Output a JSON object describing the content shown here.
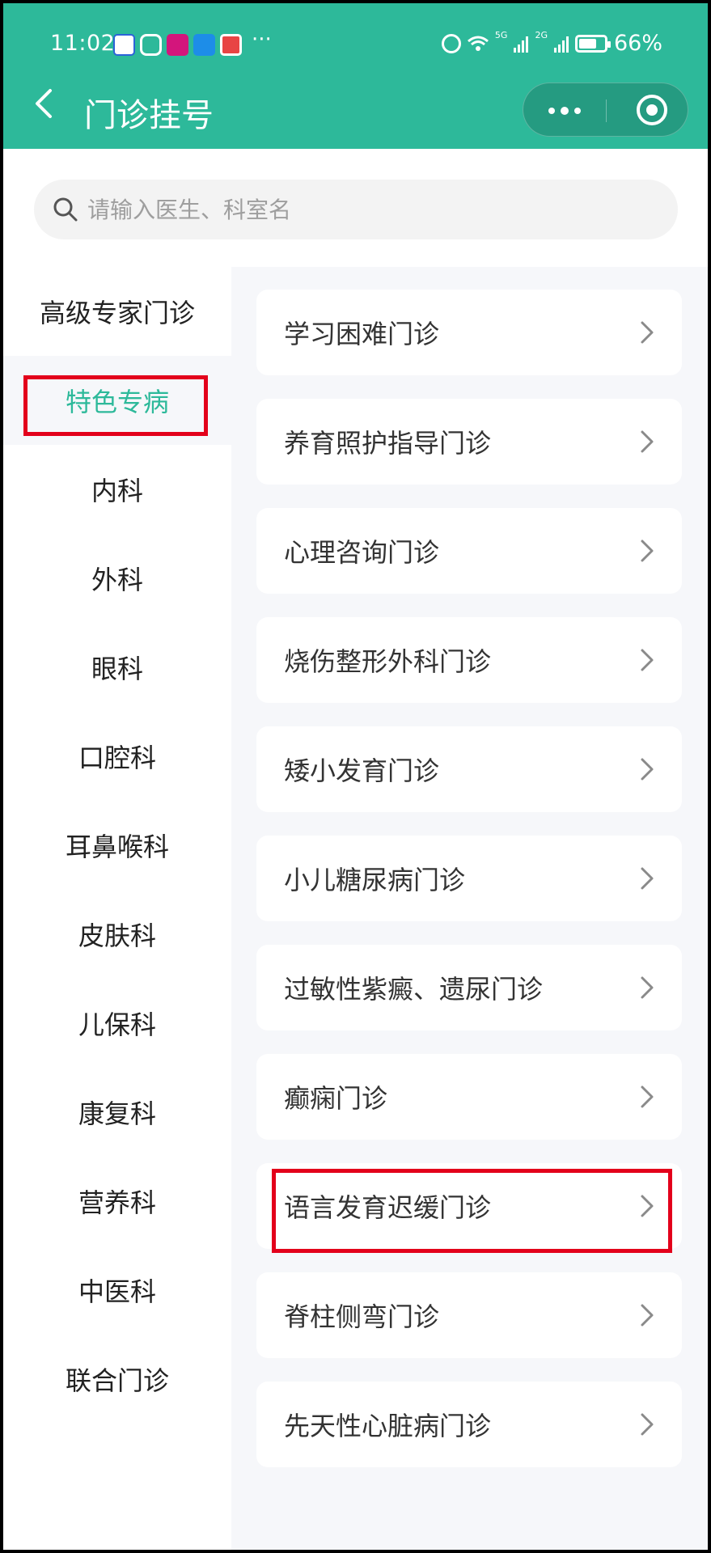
{
  "status_bar": {
    "time": "11:02",
    "more": "···",
    "battery_percent": "66%",
    "battery_level": 0.66,
    "app_icons": [
      "baidu-icon",
      "shield-icon",
      "pink-app-icon",
      "blue-app-icon",
      "red-app-icon"
    ],
    "network_tag_1": "5G",
    "network_tag_2": "2G"
  },
  "nav": {
    "title": "门诊挂号",
    "back_icon": "chevron-left-icon",
    "more_icon": "more-dots-icon",
    "close_icon": "target-circle-icon"
  },
  "search": {
    "placeholder": "请输入医生、科室名",
    "value": ""
  },
  "categories": [
    {
      "label": "高级专家门诊",
      "active": false
    },
    {
      "label": "特色专病",
      "active": true
    },
    {
      "label": "内科",
      "active": false
    },
    {
      "label": "外科",
      "active": false
    },
    {
      "label": "眼科",
      "active": false
    },
    {
      "label": "口腔科",
      "active": false
    },
    {
      "label": "耳鼻喉科",
      "active": false
    },
    {
      "label": "皮肤科",
      "active": false
    },
    {
      "label": "儿保科",
      "active": false
    },
    {
      "label": "康复科",
      "active": false
    },
    {
      "label": "营养科",
      "active": false
    },
    {
      "label": "中医科",
      "active": false
    },
    {
      "label": "联合门诊",
      "active": false
    }
  ],
  "clinics": [
    {
      "label": "学习困难门诊"
    },
    {
      "label": "养育照护指导门诊"
    },
    {
      "label": "心理咨询门诊"
    },
    {
      "label": "烧伤整形外科门诊"
    },
    {
      "label": "矮小发育门诊"
    },
    {
      "label": "小儿糖尿病门诊"
    },
    {
      "label": "过敏性紫癜、遗尿门诊"
    },
    {
      "label": "癫痫门诊"
    },
    {
      "label": "语言发育迟缓门诊"
    },
    {
      "label": "脊柱侧弯门诊"
    },
    {
      "label": "先天性心脏病门诊"
    }
  ],
  "colors": {
    "brand": "#2db99a",
    "annotation": "#e3001b"
  }
}
